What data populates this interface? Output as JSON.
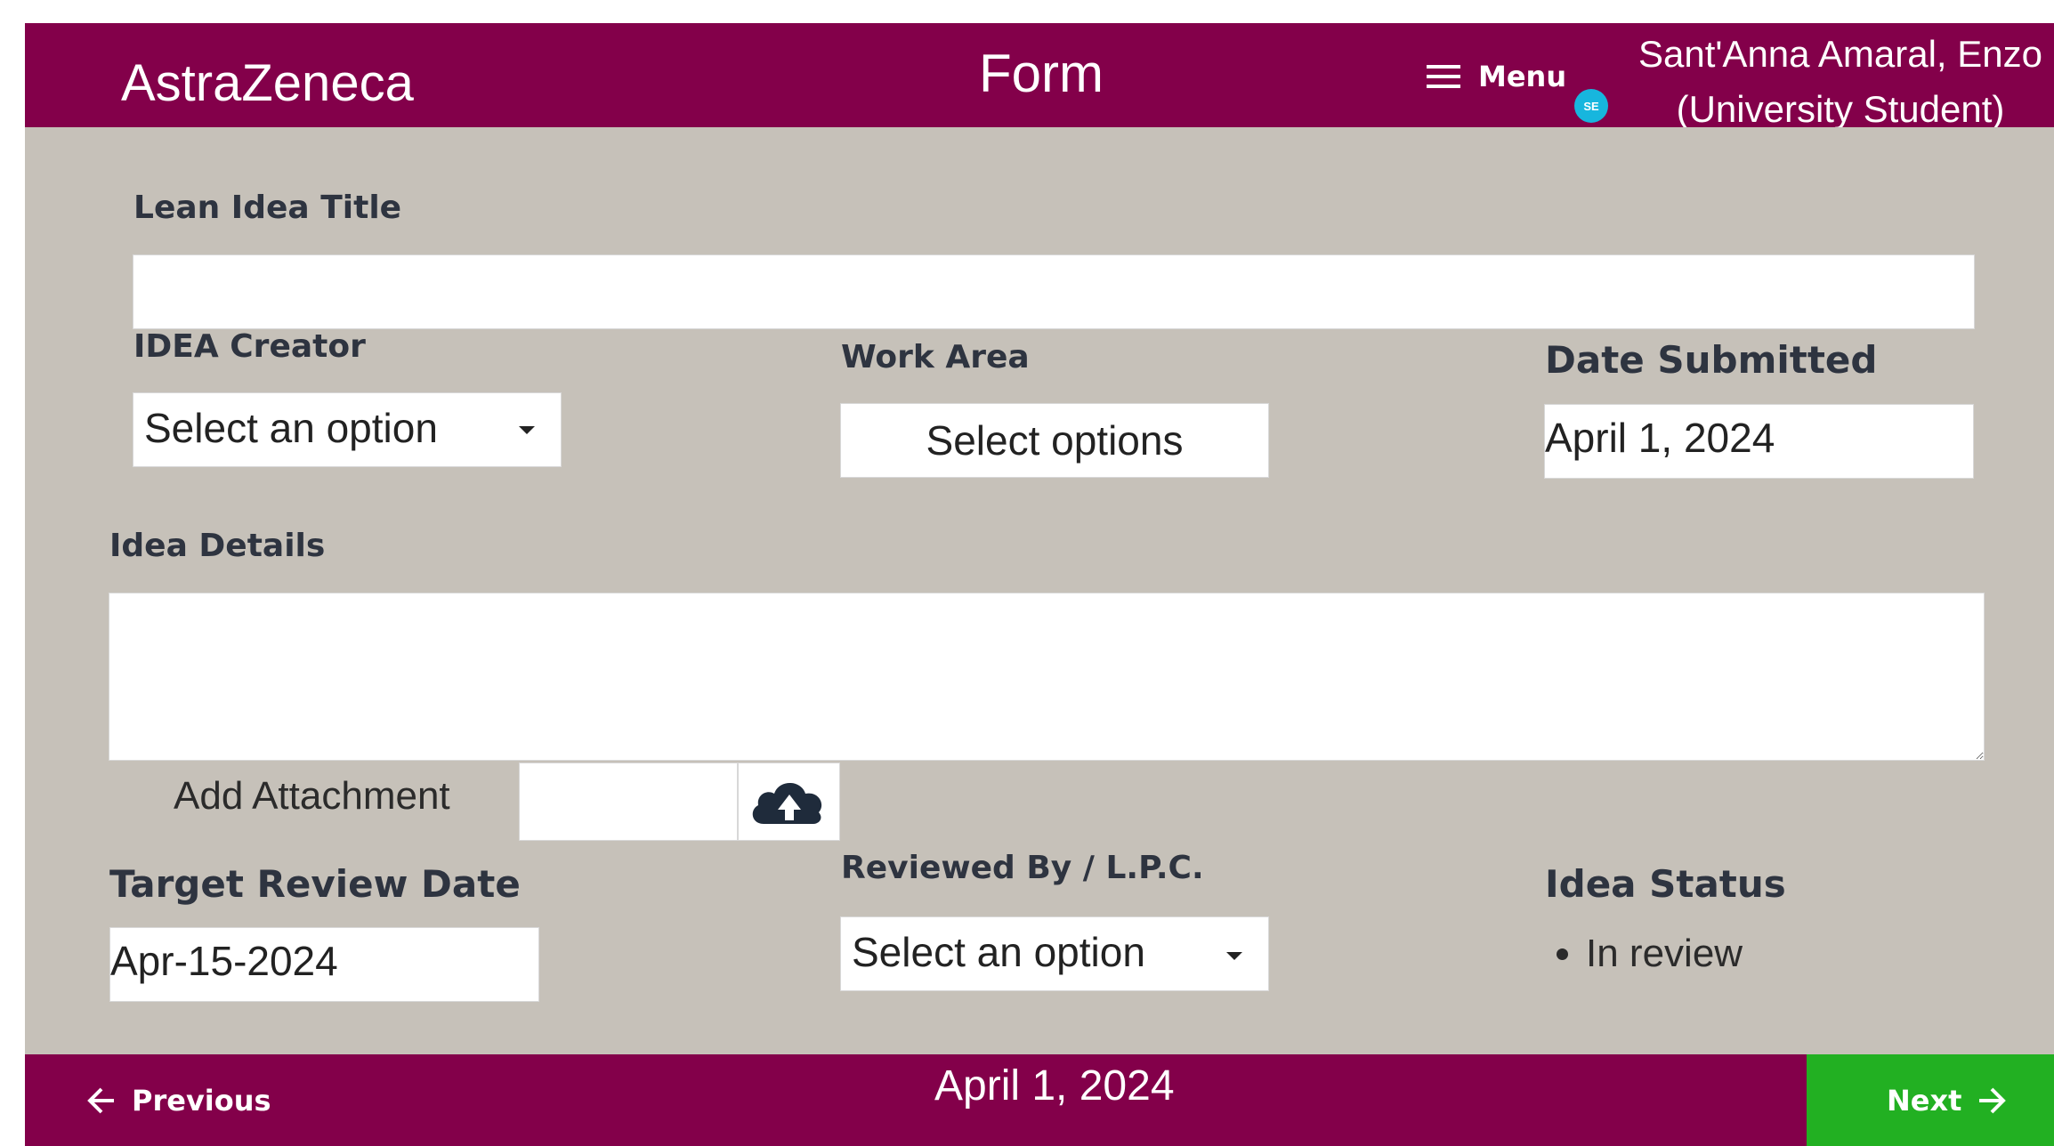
{
  "header": {
    "brand": "AstraZeneca",
    "title": "Form",
    "menu_label": "Menu",
    "avatar_initials": "SE",
    "user_name_line1": "Sant'Anna Amaral, Enzo",
    "user_name_line2": "(University Student)"
  },
  "form": {
    "title_label": "Lean Idea Title",
    "title_value": "",
    "creator_label": "IDEA Creator",
    "creator_value": "Select an option",
    "work_area_label": "Work Area",
    "work_area_value": "Select options",
    "date_submitted_label": "Date Submitted",
    "date_submitted_value": "April 1, 2024",
    "details_label": "Idea Details",
    "details_value": "",
    "attachment_label": "Add Attachment",
    "target_review_label": "Target Review Date",
    "target_review_value": "Apr-15-2024",
    "reviewed_by_label": "Reviewed By / L.P.C.",
    "reviewed_by_value": "Select an option",
    "status_label": "Idea Status",
    "status_items": [
      "In review"
    ]
  },
  "footer": {
    "previous_label": "Previous",
    "date": "April 1, 2024",
    "next_label": "Next"
  },
  "colors": {
    "brand": "#83004a",
    "background": "#c6c1b9",
    "next_button": "#22b022",
    "avatar": "#17b6de"
  },
  "icons": [
    "menu-icon",
    "upload-cloud-icon",
    "arrow-left-icon",
    "arrow-right-icon",
    "chevron-down-icon"
  ]
}
